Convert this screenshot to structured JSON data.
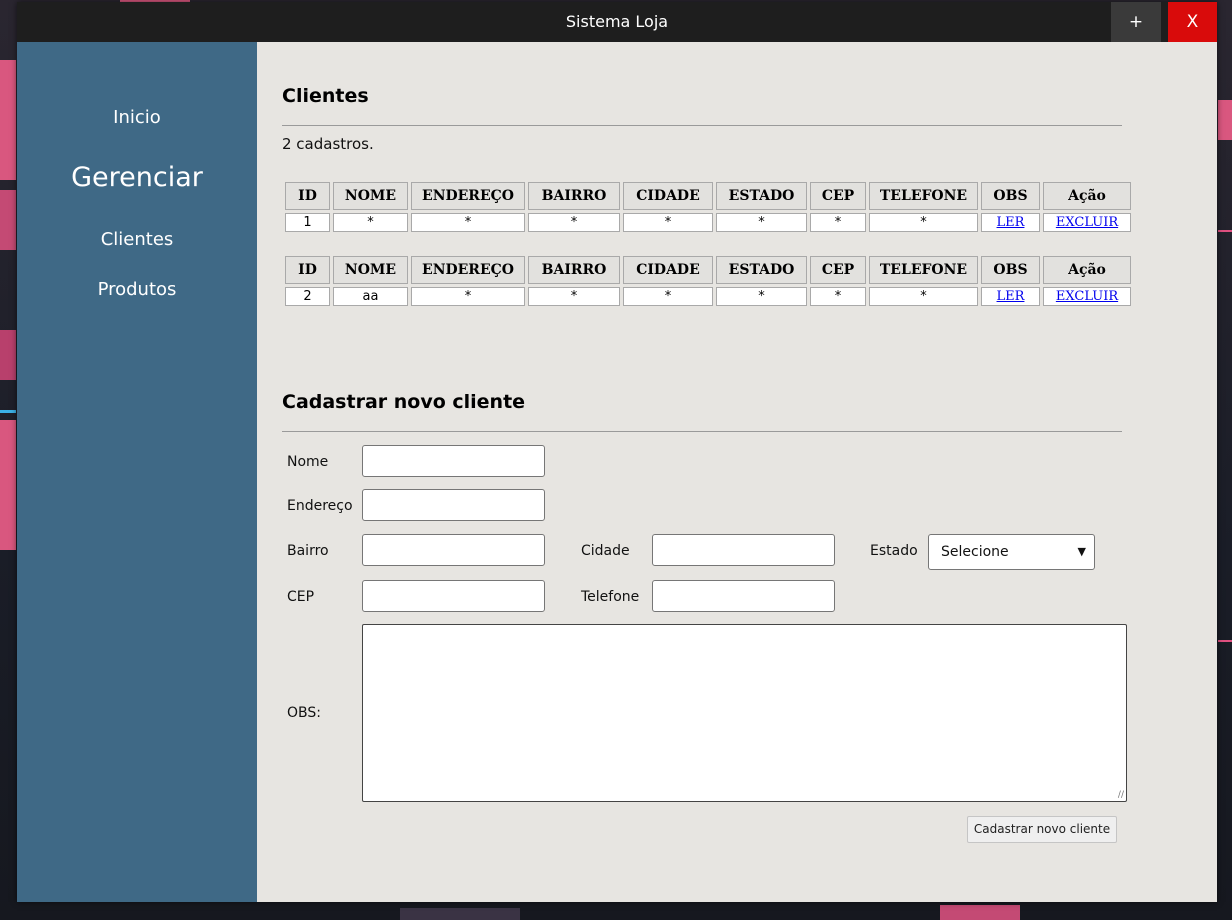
{
  "window": {
    "title": "Sistema Loja",
    "plus_label": "+",
    "close_label": "X"
  },
  "sidebar": {
    "items": [
      {
        "label": "Inicio"
      },
      {
        "label": "Gerenciar"
      },
      {
        "label": "Clientes"
      },
      {
        "label": "Produtos"
      }
    ]
  },
  "clients": {
    "title": "Clientes",
    "count_text": "2 cadastros.",
    "columns": [
      "ID",
      "NOME",
      "ENDEREÇO",
      "BAIRRO",
      "CIDADE",
      "ESTADO",
      "CEP",
      "TELEFONE",
      "OBS",
      "Ação"
    ],
    "records": [
      {
        "cells": [
          "1",
          "*",
          "*",
          "*",
          "*",
          "*",
          "*",
          "*"
        ],
        "obs_link": "LER",
        "action_link": "EXCLUIR"
      },
      {
        "cells": [
          "2",
          "aa",
          "*",
          "*",
          "*",
          "*",
          "*",
          "*"
        ],
        "obs_link": "LER",
        "action_link": "EXCLUIR"
      }
    ]
  },
  "form": {
    "title": "Cadastrar novo cliente",
    "labels": {
      "nome": "Nome",
      "endereco": "Endereço",
      "bairro": "Bairro",
      "cidade": "Cidade",
      "estado": "Estado",
      "cep": "CEP",
      "telefone": "Telefone",
      "obs": "OBS:"
    },
    "values": {
      "nome": "",
      "endereco": "",
      "bairro": "",
      "cidade": "",
      "cep": "",
      "telefone": "",
      "obs": ""
    },
    "estado_selected": "Selecione",
    "submit_label": "Cadastrar novo cliente"
  },
  "colors": {
    "titlebar": "#1e1e1e",
    "close_button": "#d90b0b",
    "sidebar": "#3f6986",
    "content_bg": "#e7e5e1",
    "link": "#0000ee"
  }
}
